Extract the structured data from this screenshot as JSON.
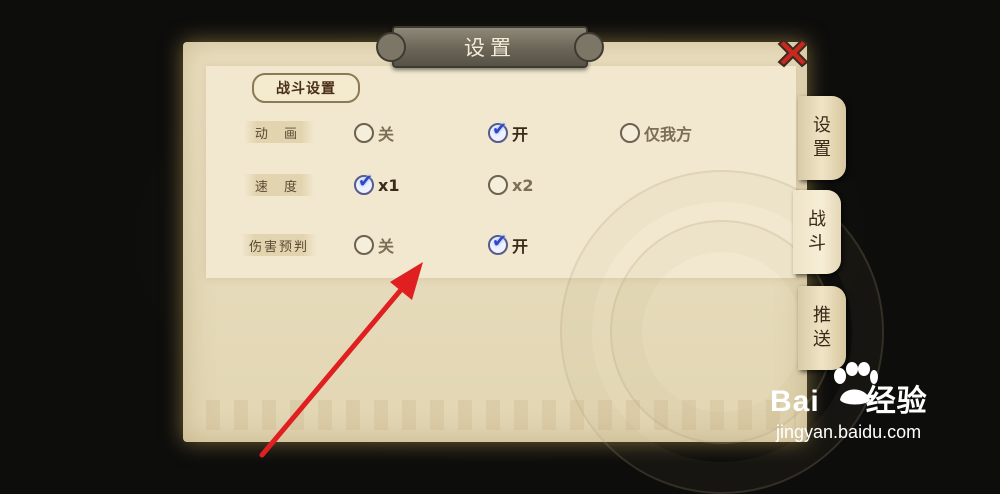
{
  "title": "设置",
  "section_header": "战斗设置",
  "rows": [
    {
      "label": "动 画",
      "options": [
        {
          "label": "关",
          "selected": false
        },
        {
          "label": "开",
          "selected": true
        },
        {
          "label": "仅我方",
          "selected": false
        }
      ]
    },
    {
      "label": "速 度",
      "options": [
        {
          "label": "x1",
          "selected": true
        },
        {
          "label": "x2",
          "selected": false
        }
      ]
    },
    {
      "label": "伤害预判",
      "options": [
        {
          "label": "关",
          "selected": false
        },
        {
          "label": "开",
          "selected": true
        }
      ]
    }
  ],
  "side_tabs": [
    {
      "line1": "设",
      "line2": "置",
      "active": false
    },
    {
      "line1": "战",
      "line2": "斗",
      "active": true
    },
    {
      "line1": "推",
      "line2": "送",
      "active": false
    }
  ],
  "check_glyph": "✔",
  "watermark": {
    "brand_left": "Bai",
    "brand_right": "经验",
    "url": "jingyan.baidu.com"
  },
  "colors": {
    "close_red": "#c8281e",
    "arrow_red": "#e02020",
    "parchment": "#ebe0c2"
  }
}
